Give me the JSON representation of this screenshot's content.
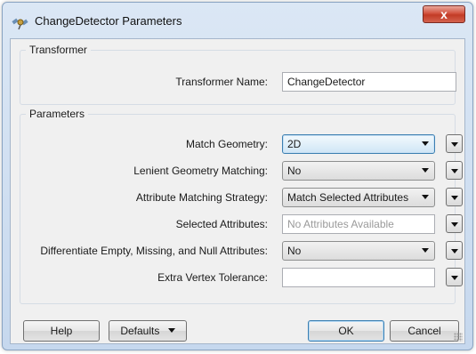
{
  "window": {
    "title": "ChangeDetector Parameters",
    "close_label": "x"
  },
  "transformer": {
    "group_label": "Transformer",
    "name_label": "Transformer Name:",
    "name_value": "ChangeDetector"
  },
  "parameters": {
    "group_label": "Parameters",
    "match_geometry": {
      "label": "Match Geometry:",
      "value": "2D"
    },
    "lenient_geometry": {
      "label": "Lenient Geometry Matching:",
      "value": "No"
    },
    "attribute_strategy": {
      "label": "Attribute Matching Strategy:",
      "value": "Match Selected Attributes"
    },
    "selected_attributes": {
      "label": "Selected Attributes:",
      "placeholder": "No Attributes Available"
    },
    "differentiate": {
      "label": "Differentiate Empty, Missing, and Null Attributes:",
      "value": "No"
    },
    "extra_vertex": {
      "label": "Extra Vertex Tolerance:",
      "value": ""
    }
  },
  "buttons": {
    "help": "Help",
    "defaults": "Defaults",
    "ok": "OK",
    "cancel": "Cancel"
  },
  "icons": {
    "app": "satellite-icon",
    "close": "close-icon",
    "dropdown": "chevron-down-icon"
  }
}
